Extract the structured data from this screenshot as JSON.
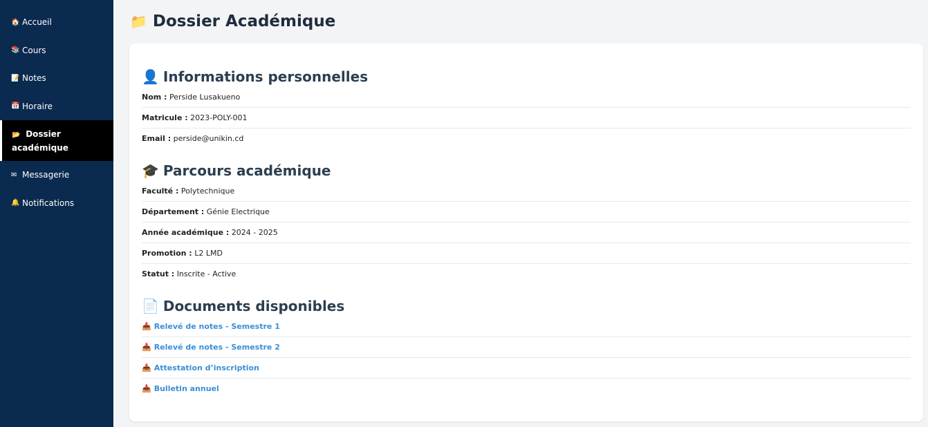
{
  "sidebar": {
    "items": [
      {
        "icon": "home-icon",
        "glyph": "🏠",
        "label": "Accueil"
      },
      {
        "icon": "books-icon",
        "glyph": "📚",
        "label": "Cours"
      },
      {
        "icon": "memo-icon",
        "glyph": "📝",
        "label": "Notes"
      },
      {
        "icon": "calendar-icon",
        "glyph": "📅",
        "label": "Horaire"
      },
      {
        "icon": "folder-icon",
        "glyph": "📂",
        "label": "Dossier académique",
        "label_line1": "Dossier",
        "label_line2": "académique",
        "active": true
      },
      {
        "icon": "envelope-icon",
        "glyph": "✉",
        "label": "Messagerie"
      },
      {
        "icon": "bell-icon",
        "glyph": "🔔",
        "label": "Notifications"
      }
    ]
  },
  "page": {
    "title": "Dossier Académique",
    "title_icon": "📁"
  },
  "personal": {
    "title": "Informations personnelles",
    "icon": "👤",
    "rows": [
      {
        "label": "Nom :",
        "value": "Perside Lusakueno"
      },
      {
        "label": "Matricule :",
        "value": "2023-POLY-001"
      },
      {
        "label": "Email :",
        "value": "perside@unikin.cd"
      }
    ]
  },
  "academic": {
    "title": "Parcours académique",
    "icon": "🎓",
    "rows": [
      {
        "label": "Faculté :",
        "value": "Polytechnique"
      },
      {
        "label": "Département :",
        "value": "Génie Electrique"
      },
      {
        "label": "Année académique :",
        "value": "2024 - 2025"
      },
      {
        "label": "Promotion :",
        "value": "L2 LMD"
      },
      {
        "label": "Statut :",
        "value": "Inscrite - Active"
      }
    ]
  },
  "documents": {
    "title": "Documents disponibles",
    "icon": "📄",
    "download_glyph": "📥",
    "links": [
      "Relevé de notes - Semestre 1",
      "Relevé de notes - Semestre 2",
      "Attestation d’inscription",
      "Bulletin annuel"
    ]
  },
  "colors": {
    "sidebar_bg": "#0a2a4f",
    "active_bg": "#000000",
    "link": "#3a8fd6",
    "heading": "#2c3e50"
  }
}
